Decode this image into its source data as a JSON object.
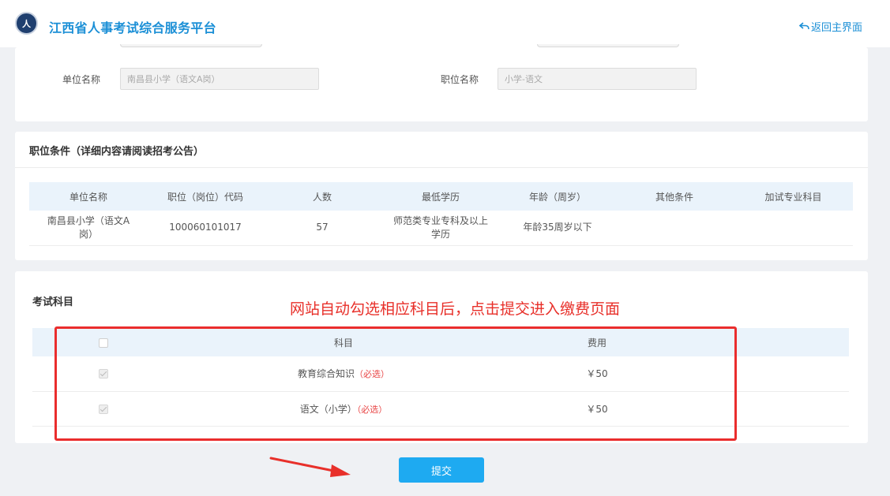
{
  "header": {
    "logo_text": "人",
    "title": "江西省人事考试综合服务平台",
    "back_label": "返回主界面"
  },
  "unit": {
    "label": "单位名称",
    "value": "南昌县小学（语文A岗）"
  },
  "position": {
    "label": "职位名称",
    "value": "小学-语文"
  },
  "conditions": {
    "title": "职位条件（详细内容请阅读招考公告）",
    "columns": [
      "单位名称",
      "职位（岗位）代码",
      "人数",
      "最低学历",
      "年龄（周岁）",
      "其他条件",
      "加试专业科目"
    ],
    "row": {
      "unit": "南昌县小学（语文A岗）",
      "code": "100060101017",
      "count": "57",
      "education": "师范类专业专科及以上学历",
      "age": "年龄35周岁以下",
      "other": "",
      "extra_subject": ""
    }
  },
  "exam": {
    "title": "考试科目",
    "col_subject": "科目",
    "col_fee": "费用",
    "rows": [
      {
        "subject": "教育综合知识",
        "required": "（必选）",
        "fee": "￥50",
        "checked": true
      },
      {
        "subject": "语文（小学）",
        "required": "（必选）",
        "fee": "￥50",
        "checked": true
      }
    ]
  },
  "annotation": "网站自动勾选相应科目后，点击提交进入缴费页面",
  "submit_label": "提交",
  "colors": {
    "brand": "#1b8fd6",
    "button": "#1eaaf1",
    "annotation": "#e8302a",
    "required": "#e84545"
  }
}
